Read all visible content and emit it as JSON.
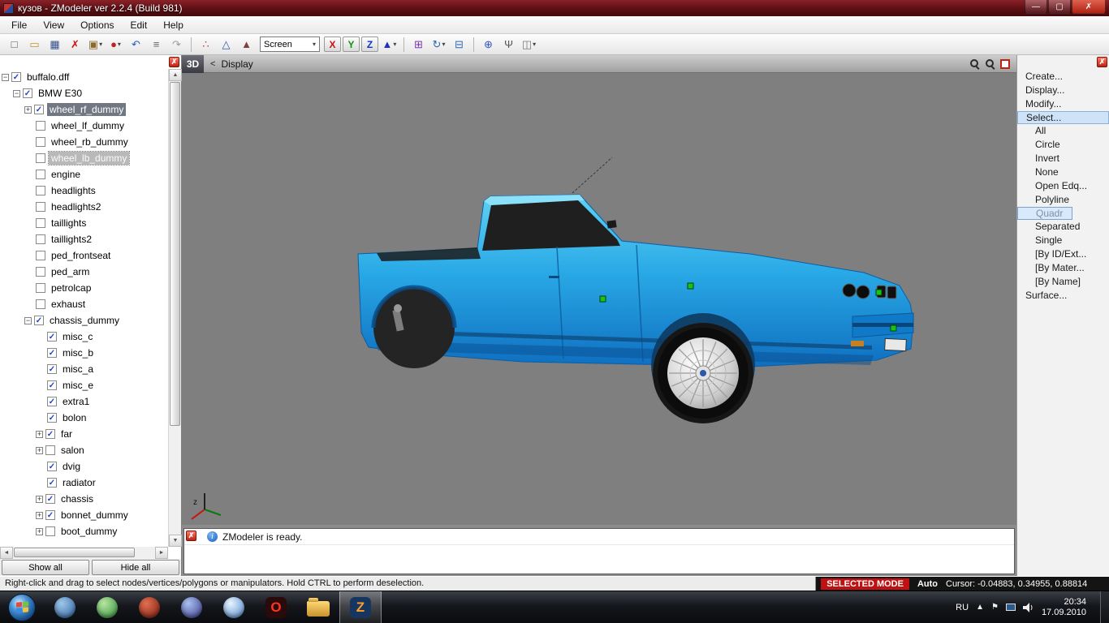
{
  "colors": {
    "car_body": "#29a9e6",
    "selection_marker": "#17c317",
    "mode_badge_bg": "#bf1111",
    "viewport_bg": "#7f7f7f"
  },
  "icons": {
    "close_glyph": "✗",
    "dropdown_glyph": "▾",
    "check_glyph": "✓",
    "plus_glyph": "+",
    "minus_glyph": "−",
    "up_glyph": "▲",
    "down_glyph": "▼",
    "left_glyph": "◄",
    "right_glyph": "►",
    "chevron_up_glyph": "▲",
    "flag_glyph": "⚑"
  },
  "window": {
    "title": "кузов - ZModeler ver 2.2.4 (Build 981)",
    "controls": {
      "minimize": "—",
      "maximize": "▢",
      "close": "✗"
    }
  },
  "menubar": {
    "items": [
      "File",
      "View",
      "Options",
      "Edit",
      "Help"
    ]
  },
  "toolbar": {
    "items": [
      {
        "type": "icon",
        "name": "new-file-icon",
        "glyph": "□",
        "color": "#555555"
      },
      {
        "type": "icon",
        "name": "open-folder-icon",
        "glyph": "▭",
        "color": "#c4922e"
      },
      {
        "type": "icon",
        "name": "save-icon",
        "glyph": "▦",
        "color": "#33508c"
      },
      {
        "type": "icon",
        "name": "delete-icon",
        "glyph": "✗",
        "color": "#cc1111"
      },
      {
        "type": "icon",
        "name": "import-export-icon",
        "glyph": "▣",
        "color": "#8a6a2a",
        "dropdown": true
      },
      {
        "type": "icon",
        "name": "material-editor-icon",
        "glyph": "●",
        "color": "#c22222",
        "dropdown": true
      },
      {
        "type": "icon",
        "name": "undo-icon",
        "glyph": "↶",
        "color": "#2b5bc8"
      },
      {
        "type": "icon",
        "name": "notes-icon",
        "glyph": "≡",
        "color": "#666666"
      },
      {
        "type": "icon",
        "name": "redo-icon",
        "glyph": "↷",
        "color": "#9a9a9a"
      },
      {
        "type": "sep"
      },
      {
        "type": "icon",
        "name": "select-vertices-icon",
        "glyph": "∴",
        "color": "#c03030"
      },
      {
        "type": "icon",
        "name": "select-edges-icon",
        "glyph": "△",
        "color": "#3050b0"
      },
      {
        "type": "icon",
        "name": "select-polygons-icon",
        "glyph": "▲",
        "color": "#804040"
      },
      {
        "type": "combo",
        "name": "screen-mode-select",
        "label": "Screen"
      },
      {
        "type": "axis",
        "name": "axis-x-toggle",
        "label": "X",
        "color": "#cc1111"
      },
      {
        "type": "axis",
        "name": "axis-y-toggle",
        "label": "Y",
        "color": "#0d930d"
      },
      {
        "type": "axis",
        "name": "axis-z-toggle",
        "label": "Z",
        "color": "#1133cc"
      },
      {
        "type": "icon",
        "name": "normals-icon",
        "glyph": "▲",
        "color": "#2233bb",
        "dropdown": true
      },
      {
        "type": "sep"
      },
      {
        "type": "icon",
        "name": "manip-move-icon",
        "glyph": "⊞",
        "color": "#7a35aa"
      },
      {
        "type": "icon",
        "name": "manip-rotate-icon",
        "glyph": "↻",
        "color": "#2a6ab0",
        "dropdown": true
      },
      {
        "type": "icon",
        "name": "manip-scale-icon",
        "glyph": "⊟",
        "color": "#2a6ab0"
      },
      {
        "type": "sep"
      },
      {
        "type": "icon",
        "name": "snap-icon",
        "glyph": "⊕",
        "color": "#3355bb"
      },
      {
        "type": "icon",
        "name": "bones-icon",
        "glyph": "Ψ",
        "color": "#555555"
      },
      {
        "type": "icon",
        "name": "mirror-icon",
        "glyph": "◫",
        "color": "#777777",
        "dropdown": true
      }
    ]
  },
  "scene_tree": {
    "buttons": {
      "show_all": "Show all",
      "hide_all": "Hide all"
    },
    "items": [
      {
        "label": "buffalo.dff",
        "level": 0,
        "expander": "minus",
        "checked": true,
        "state": "normal"
      },
      {
        "label": "BMW E30",
        "level": 1,
        "expander": "minus",
        "checked": true,
        "state": "normal"
      },
      {
        "label": "wheel_rf_dummy",
        "level": 2,
        "expander": "plus",
        "checked": true,
        "state": "selected"
      },
      {
        "label": "wheel_lf_dummy",
        "level": 2,
        "expander": "none",
        "checked": false,
        "state": "normal"
      },
      {
        "label": "wheel_rb_dummy",
        "level": 2,
        "expander": "none",
        "checked": false,
        "state": "normal"
      },
      {
        "label": "wheel_lb_dummy",
        "level": 2,
        "expander": "none",
        "checked": false,
        "state": "focused"
      },
      {
        "label": "engine",
        "level": 2,
        "expander": "none",
        "checked": false,
        "state": "normal"
      },
      {
        "label": "headlights",
        "level": 2,
        "expander": "none",
        "checked": false,
        "state": "normal"
      },
      {
        "label": "headlights2",
        "level": 2,
        "expander": "none",
        "checked": false,
        "state": "normal"
      },
      {
        "label": "taillights",
        "level": 2,
        "expander": "none",
        "checked": false,
        "state": "normal"
      },
      {
        "label": "taillights2",
        "level": 2,
        "expander": "none",
        "checked": false,
        "state": "normal"
      },
      {
        "label": "ped_frontseat",
        "level": 2,
        "expander": "none",
        "checked": false,
        "state": "normal"
      },
      {
        "label": "ped_arm",
        "level": 2,
        "expander": "none",
        "checked": false,
        "state": "normal"
      },
      {
        "label": "petrolcap",
        "level": 2,
        "expander": "none",
        "checked": false,
        "state": "normal"
      },
      {
        "label": "exhaust",
        "level": 2,
        "expander": "none",
        "checked": false,
        "state": "normal"
      },
      {
        "label": "chassis_dummy",
        "level": 2,
        "expander": "minus",
        "checked": true,
        "state": "normal"
      },
      {
        "label": "misc_c",
        "level": 3,
        "expander": "none",
        "checked": true,
        "state": "normal"
      },
      {
        "label": "misc_b",
        "level": 3,
        "expander": "none",
        "checked": true,
        "state": "normal"
      },
      {
        "label": "misc_a",
        "level": 3,
        "expander": "none",
        "checked": true,
        "state": "normal"
      },
      {
        "label": "misc_e",
        "level": 3,
        "expander": "none",
        "checked": true,
        "state": "normal"
      },
      {
        "label": "extra1",
        "level": 3,
        "expander": "none",
        "checked": true,
        "state": "normal"
      },
      {
        "label": "bolon",
        "level": 3,
        "expander": "none",
        "checked": true,
        "state": "normal"
      },
      {
        "label": "far",
        "level": 3,
        "expander": "plus",
        "checked": true,
        "state": "normal"
      },
      {
        "label": "salon",
        "level": 3,
        "expander": "plus",
        "checked": false,
        "state": "normal"
      },
      {
        "label": "dvig",
        "level": 3,
        "expander": "none",
        "checked": true,
        "state": "normal"
      },
      {
        "label": "radiator",
        "level": 3,
        "expander": "none",
        "checked": true,
        "state": "normal"
      },
      {
        "label": "chassis",
        "level": 3,
        "expander": "plus",
        "checked": true,
        "state": "normal"
      },
      {
        "label": "bonnet_dummy",
        "level": 3,
        "expander": "plus",
        "checked": true,
        "state": "normal"
      },
      {
        "label": "boot_dummy",
        "level": 3,
        "expander": "plus",
        "checked": false,
        "state": "normal"
      }
    ]
  },
  "viewport": {
    "mode_button": "3D",
    "back_arrow": "<",
    "breadcrumb": "Display",
    "axis_hint": "z"
  },
  "commands_panel": {
    "items": [
      {
        "label": "Create...",
        "level": 0,
        "state": ""
      },
      {
        "label": "Display...",
        "level": 0,
        "state": ""
      },
      {
        "label": "Modify...",
        "level": 0,
        "state": ""
      },
      {
        "label": "Select...",
        "level": 0,
        "state": "active"
      },
      {
        "label": "All",
        "level": 1,
        "state": ""
      },
      {
        "label": "Circle",
        "level": 1,
        "state": ""
      },
      {
        "label": "Invert",
        "level": 1,
        "state": ""
      },
      {
        "label": "None",
        "level": 1,
        "state": ""
      },
      {
        "label": "Open Edq...",
        "level": 1,
        "state": ""
      },
      {
        "label": "Polyline",
        "level": 1,
        "state": ""
      },
      {
        "label": "Quadr",
        "level": 1,
        "state": "highlighted"
      },
      {
        "label": "Separated",
        "level": 1,
        "state": ""
      },
      {
        "label": "Single",
        "level": 1,
        "state": ""
      },
      {
        "label": "[By ID/Ext...",
        "level": 1,
        "state": ""
      },
      {
        "label": "[By Mater...",
        "level": 1,
        "state": ""
      },
      {
        "label": "[By Name]",
        "level": 1,
        "state": ""
      },
      {
        "label": "Surface...",
        "level": 0,
        "state": ""
      }
    ]
  },
  "log": {
    "message": "ZModeler is ready."
  },
  "statusbar": {
    "hint": "Right-click and drag to select nodes/vertices/polygons or manipulators. Hold CTRL to perform deselection.",
    "mode_badge": "SELECTED MODE",
    "auto": "Auto",
    "cursor": "Cursor: -0.04883, 0.34955, 0.88814"
  },
  "taskbar": {
    "language": "RU",
    "time": "20:34",
    "date": "17.09.2010",
    "apps": [
      {
        "name": "taskbar-app-browser-1",
        "kind": "circle",
        "c1": "#9ec7e8",
        "c2": "#2a5f9e"
      },
      {
        "name": "taskbar-app-browser-2",
        "kind": "circle",
        "c1": "#b8e6a0",
        "c2": "#2e8b3a"
      },
      {
        "name": "taskbar-app-media",
        "kind": "circle",
        "c1": "#e07050",
        "c2": "#7a1a10"
      },
      {
        "name": "taskbar-app-messenger",
        "kind": "circle",
        "c1": "#a8c0f0",
        "c2": "#3a3a8a"
      },
      {
        "name": "taskbar-app-qip",
        "kind": "circle",
        "c1": "#eaf4ff",
        "c2": "#4a86c8"
      },
      {
        "name": "taskbar-app-opera",
        "kind": "letter",
        "letter": "O",
        "c1": "#ff3322",
        "c2": "#2a0a0a"
      },
      {
        "name": "taskbar-app-explorer",
        "kind": "folder",
        "c1": "#ffd978",
        "c2": "#c8922a"
      },
      {
        "name": "taskbar-app-zmodeler",
        "kind": "letter",
        "letter": "Z",
        "c1": "#ff9d2a",
        "c2": "#16365f",
        "active": true
      }
    ]
  }
}
